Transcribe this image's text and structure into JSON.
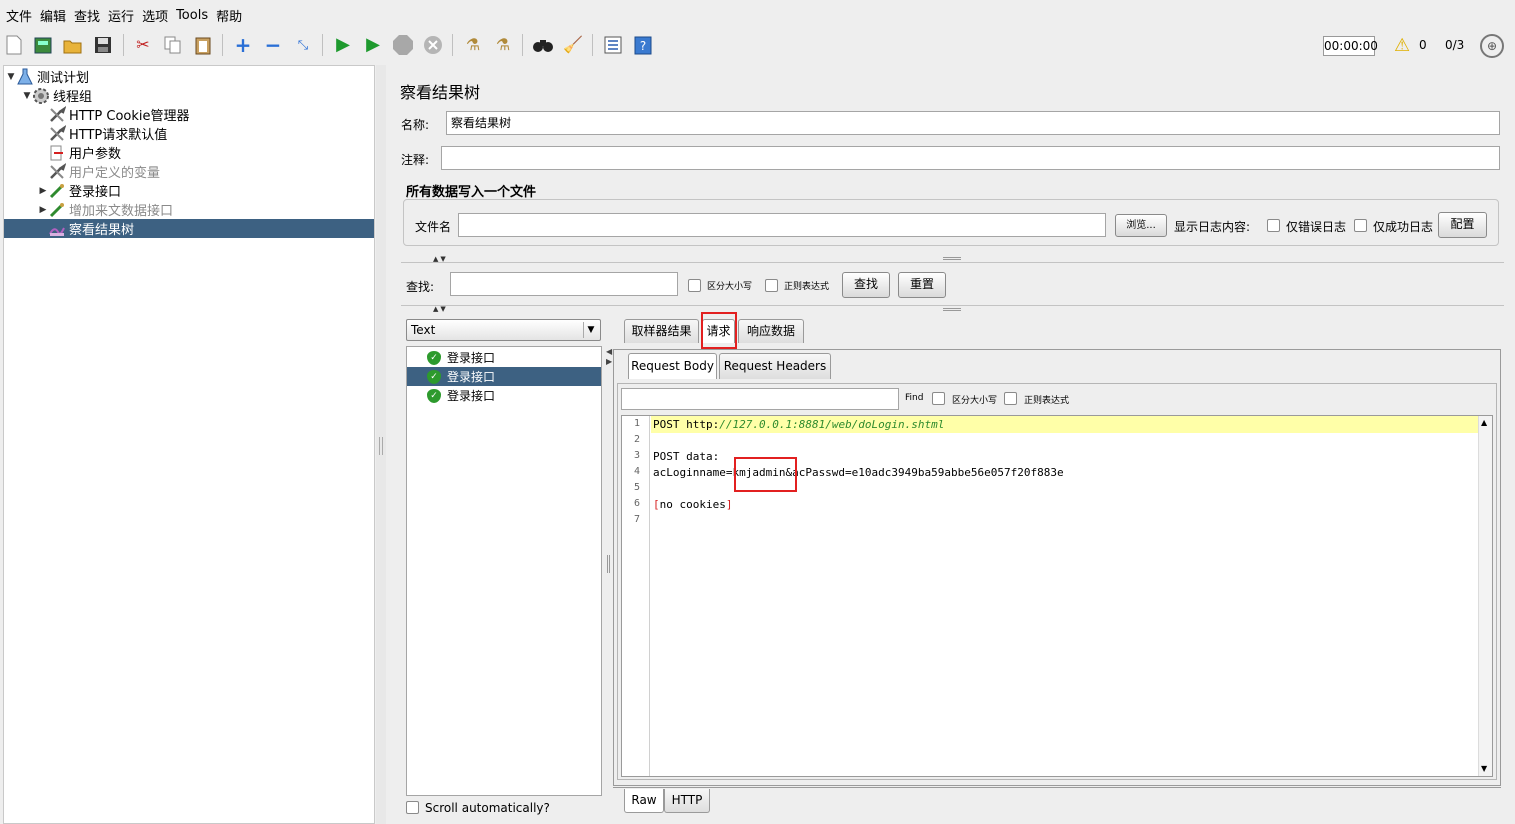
{
  "menu": [
    "文件",
    "编辑",
    "查找",
    "运行",
    "选项",
    "Tools",
    "帮助"
  ],
  "toolbar": {
    "timer": "00:00:00",
    "warning_count": "0",
    "threads": "0/3",
    "icons": [
      "new-icon",
      "templates-icon",
      "open-icon",
      "save-icon",
      "cut-icon",
      "copy-icon",
      "paste-icon",
      "expand-icon",
      "collapse-icon",
      "toggle-icon",
      "start-icon",
      "start-no-pause-icon",
      "stop-icon",
      "shutdown-icon",
      "clear-icon",
      "clear-all-icon",
      "search-icon",
      "reset-search-icon",
      "function-helper-icon",
      "help-icon"
    ]
  },
  "tree": [
    {
      "label": "测试计划",
      "icon": "test-plan-icon",
      "level": 0,
      "toggle": "▼",
      "disabled": false,
      "selected": false
    },
    {
      "label": "线程组",
      "icon": "thread-group-icon",
      "level": 1,
      "toggle": "▼",
      "disabled": false,
      "selected": false
    },
    {
      "label": "HTTP Cookie管理器",
      "icon": "wrench-icon",
      "level": 2,
      "toggle": "",
      "disabled": false,
      "selected": false
    },
    {
      "label": "HTTP请求默认值",
      "icon": "wrench-icon",
      "level": 2,
      "toggle": "",
      "disabled": false,
      "selected": false
    },
    {
      "label": "用户参数",
      "icon": "preprocessor-icon",
      "level": 2,
      "toggle": "",
      "disabled": false,
      "selected": false
    },
    {
      "label": "用户定义的变量",
      "icon": "wrench-icon",
      "level": 2,
      "toggle": "",
      "disabled": true,
      "selected": false
    },
    {
      "label": "登录接口",
      "icon": "sampler-icon",
      "level": 2,
      "toggle": "▶",
      "disabled": false,
      "selected": false
    },
    {
      "label": "增加来文数据接口",
      "icon": "sampler-icon",
      "level": 2,
      "toggle": "▶",
      "disabled": true,
      "selected": false
    },
    {
      "label": "察看结果树",
      "icon": "listener-icon",
      "level": 2,
      "toggle": "",
      "disabled": false,
      "selected": true
    }
  ],
  "panel": {
    "title": "察看结果树",
    "name_label": "名称:",
    "name_value": "察看结果树",
    "comment_label": "注释:",
    "comment_value": "",
    "file_section_title": "所有数据写入一个文件",
    "filename_label": "文件名",
    "filename_value": "",
    "browse_button": "浏览...",
    "log_content_label": "显示日志内容:",
    "errors_only_label": "仅错误日志",
    "success_only_label": "仅成功日志",
    "configure_button": "配置"
  },
  "search": {
    "label": "查找:",
    "value": "",
    "case_label": "区分大小写",
    "regex_label": "正则表达式",
    "find_button": "查找",
    "reset_button": "重置"
  },
  "results": {
    "renderer": "Text",
    "items": [
      {
        "label": "登录接口",
        "selected": false,
        "status": "success"
      },
      {
        "label": "登录接口",
        "selected": true,
        "status": "success"
      },
      {
        "label": "登录接口",
        "selected": false,
        "status": "success"
      }
    ],
    "scroll_auto_label": "Scroll automatically?"
  },
  "tabs": [
    "取样器结果",
    "请求",
    "响应数据"
  ],
  "active_tab": "请求",
  "subtabs": [
    "Request Body",
    "Request Headers"
  ],
  "active_subtab": "Request Body",
  "find_bar": {
    "value": "",
    "find_label": "Find",
    "case_label": "区分大小写",
    "regex_label": "正则表达式"
  },
  "request_body": {
    "line_numbers": [
      "1",
      "2",
      "3",
      "4",
      "5",
      "6",
      "7"
    ],
    "line1_method": "POST http:",
    "line1_url": "//127.0.0.1:8881/web/doLogin.shtml",
    "line3": "POST data:",
    "line4": "acLoginname=kmjadmin&acPasswd=e10adc3949ba59abbe56e057f20f883e",
    "line6_open": "[",
    "line6_text": "no cookies",
    "line6_close": "]"
  },
  "bottom_tabs": [
    "Raw",
    "HTTP"
  ],
  "active_bottom_tab": "Raw",
  "colors": {
    "selection": "#3d6182",
    "highlight_line": "#ffffa8",
    "annotation_box": "#e22020",
    "url_green": "#2e8b2e"
  }
}
